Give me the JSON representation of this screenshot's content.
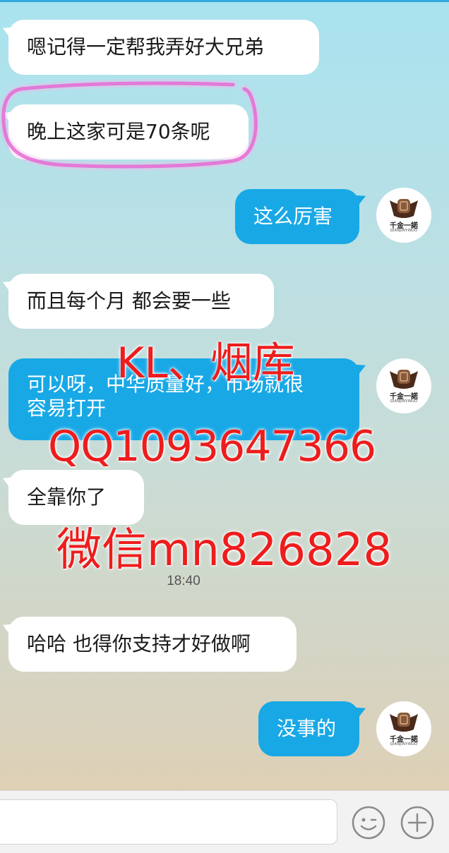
{
  "messages": [
    {
      "id": "m1",
      "side": "in",
      "text": "嗯记得一定帮我弄好大兄弟"
    },
    {
      "id": "m2",
      "side": "in",
      "text": "晚上这家可是70条呢"
    },
    {
      "id": "m3",
      "side": "out",
      "text": "这么厉害"
    },
    {
      "id": "m4",
      "side": "in",
      "text": "而且每个月 都会要一些"
    },
    {
      "id": "m5",
      "side": "out",
      "text": "可以呀，中华质量好，市场就很\n容易打开"
    },
    {
      "id": "m6",
      "side": "in",
      "text": "全靠你了"
    },
    {
      "id": "m7",
      "side": "in",
      "text": "哈哈 也得你支持才好做啊"
    },
    {
      "id": "m8",
      "side": "out",
      "text": "没事的"
    }
  ],
  "timestamp": "18:40",
  "avatar": {
    "name": "千金一諾",
    "subtitle": "QIANJINYINUO",
    "icon": "gold-ingot-logo-icon"
  },
  "watermark": {
    "line1": "KL、烟库",
    "line2": "QQ1093647366",
    "line3": "微信mn826828",
    "color": "#ee1c1c"
  },
  "annotation": {
    "color": "#e040c8"
  },
  "input": {
    "placeholder": "",
    "emoji_icon": "emoji-face-icon",
    "add_icon": "plus-circle-icon"
  },
  "colors": {
    "outgoing_bubble": "#18a8e6",
    "incoming_bubble": "#ffffff",
    "top_accent": "#35a9df"
  }
}
